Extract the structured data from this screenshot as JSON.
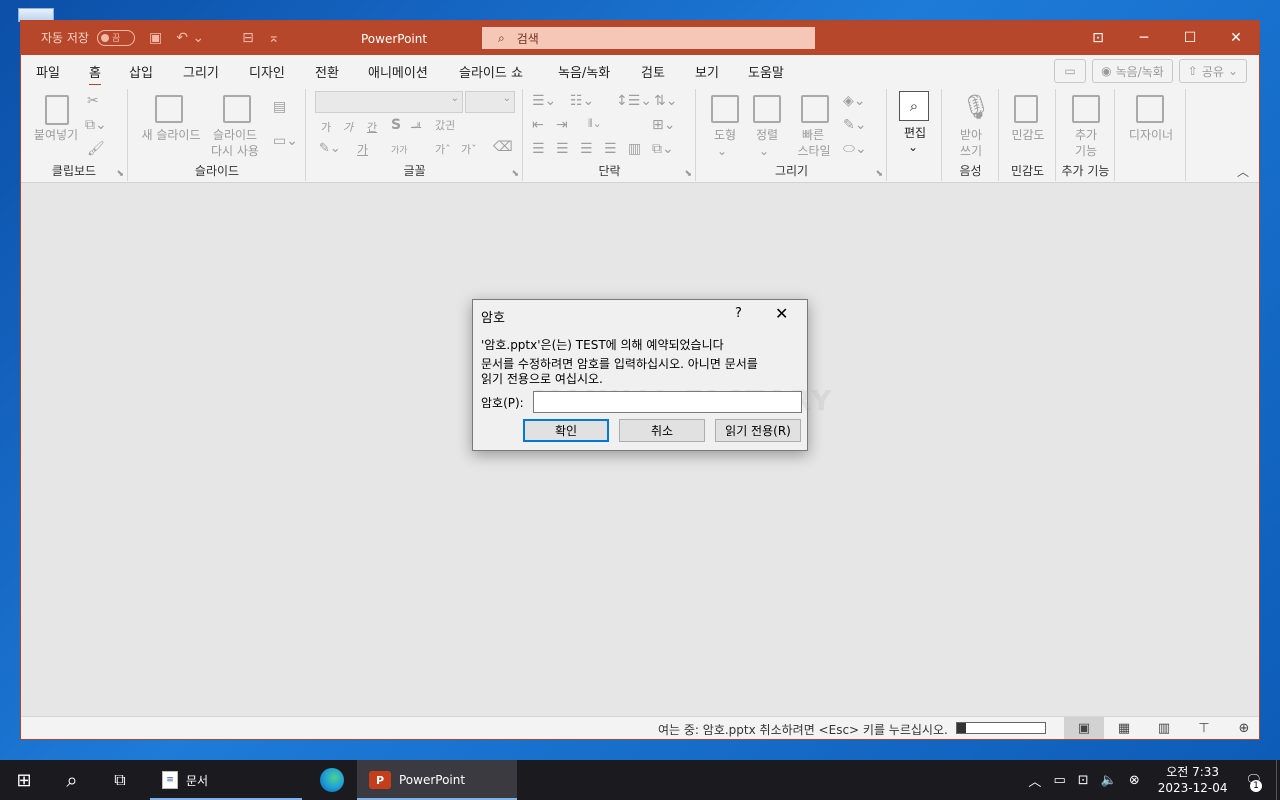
{
  "titlebar": {
    "autosave_label": "자동 저장",
    "autosave_state": "끔",
    "app_title": "PowerPoint",
    "search_placeholder": "검색",
    "colors": {
      "accent": "#b7472a",
      "search_bg": "#f4c7b6"
    }
  },
  "tabs": [
    {
      "label": "파일"
    },
    {
      "label": "홈",
      "active": true
    },
    {
      "label": "삽입"
    },
    {
      "label": "그리기"
    },
    {
      "label": "디자인"
    },
    {
      "label": "전환"
    },
    {
      "label": "애니메이션"
    },
    {
      "label": "슬라이드 쇼"
    },
    {
      "label": "녹음/녹화"
    },
    {
      "label": "검토"
    },
    {
      "label": "보기"
    },
    {
      "label": "도움말"
    }
  ],
  "tab_right": {
    "record_label": "녹음/녹화",
    "share_label": "공유"
  },
  "ribbon": {
    "clipboard": {
      "paste": "붙여넣기",
      "group": "클립보드"
    },
    "slides": {
      "new_slide": "새 슬라이드",
      "reuse_1": "슬라이드",
      "reuse_2": "다시 사용",
      "group": "슬라이드"
    },
    "font": {
      "bold": "가",
      "italic": "가",
      "underline": "간",
      "strike": "S",
      "strike2": "ᆊ",
      "spacing": "갔긘",
      "font_color": "가",
      "case": "가가",
      "grow": "가ˆ",
      "shrink": "가ˇ",
      "group": "글꼴"
    },
    "paragraph": {
      "group": "단락"
    },
    "drawing": {
      "shape": "도형",
      "arrange": "정렬",
      "quick_1": "빠른",
      "quick_2": "스타일",
      "group": "그리기"
    },
    "editing": {
      "label": "편집"
    },
    "voice": {
      "dictate_1": "받아",
      "dictate_2": "쓰기",
      "group": "음성"
    },
    "sensitivity": {
      "label": "민감도",
      "group": "민감도"
    },
    "addins": {
      "label_1": "추가",
      "label_2": "기능",
      "group": "추가 기능"
    },
    "designer": {
      "label": "디자이너"
    }
  },
  "dialog": {
    "title": "암호",
    "help": "?",
    "message_1": "'암호.pptx'은(는) TEST에 의해 예약되었습니다",
    "message_2": "문서를 수정하려면 암호를 입력하십시오. 아니면 문서를",
    "message_3": "읽기 전용으로 여십시오.",
    "password_label": "암호(P):",
    "password_value": "",
    "watermark": "MANUAL FACTORY",
    "ok": "확인",
    "cancel": "취소",
    "read_only": "읽기 전용(R)"
  },
  "status": {
    "text": "여는 중: 암호.pptx 취소하려면 <Esc> 키를 누르십시오.",
    "progress": 0.1
  },
  "taskbar": {
    "apps": [
      {
        "label": "문서",
        "icon": "document-icon"
      },
      {
        "label": "",
        "icon": "edge-icon"
      },
      {
        "label": "PowerPoint",
        "icon": "powerpoint-icon"
      }
    ],
    "clock_time": "오전 7:33",
    "clock_date": "2023-12-04",
    "notification_count": "1"
  }
}
